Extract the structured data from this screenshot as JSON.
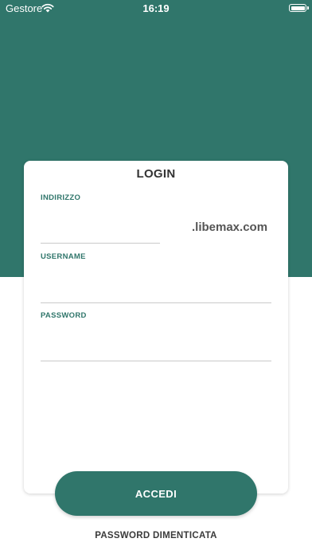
{
  "status_bar": {
    "carrier": "Gestore",
    "time": "16:19",
    "wifi_icon": "wifi-icon",
    "battery_icon": "battery-icon"
  },
  "colors": {
    "brand": "#30766b",
    "background": "#ffffff",
    "text": "#333333"
  },
  "login_card": {
    "title": "LOGIN",
    "address_label": "INDIRIZZO",
    "address_value": "",
    "domain_suffix": ".libemax.com",
    "username_label": "USERNAME",
    "username_value": "",
    "password_label": "PASSWORD",
    "password_value": ""
  },
  "actions": {
    "login_label": "ACCEDI",
    "forgot_password_label": "PASSWORD DIMENTICATA"
  }
}
